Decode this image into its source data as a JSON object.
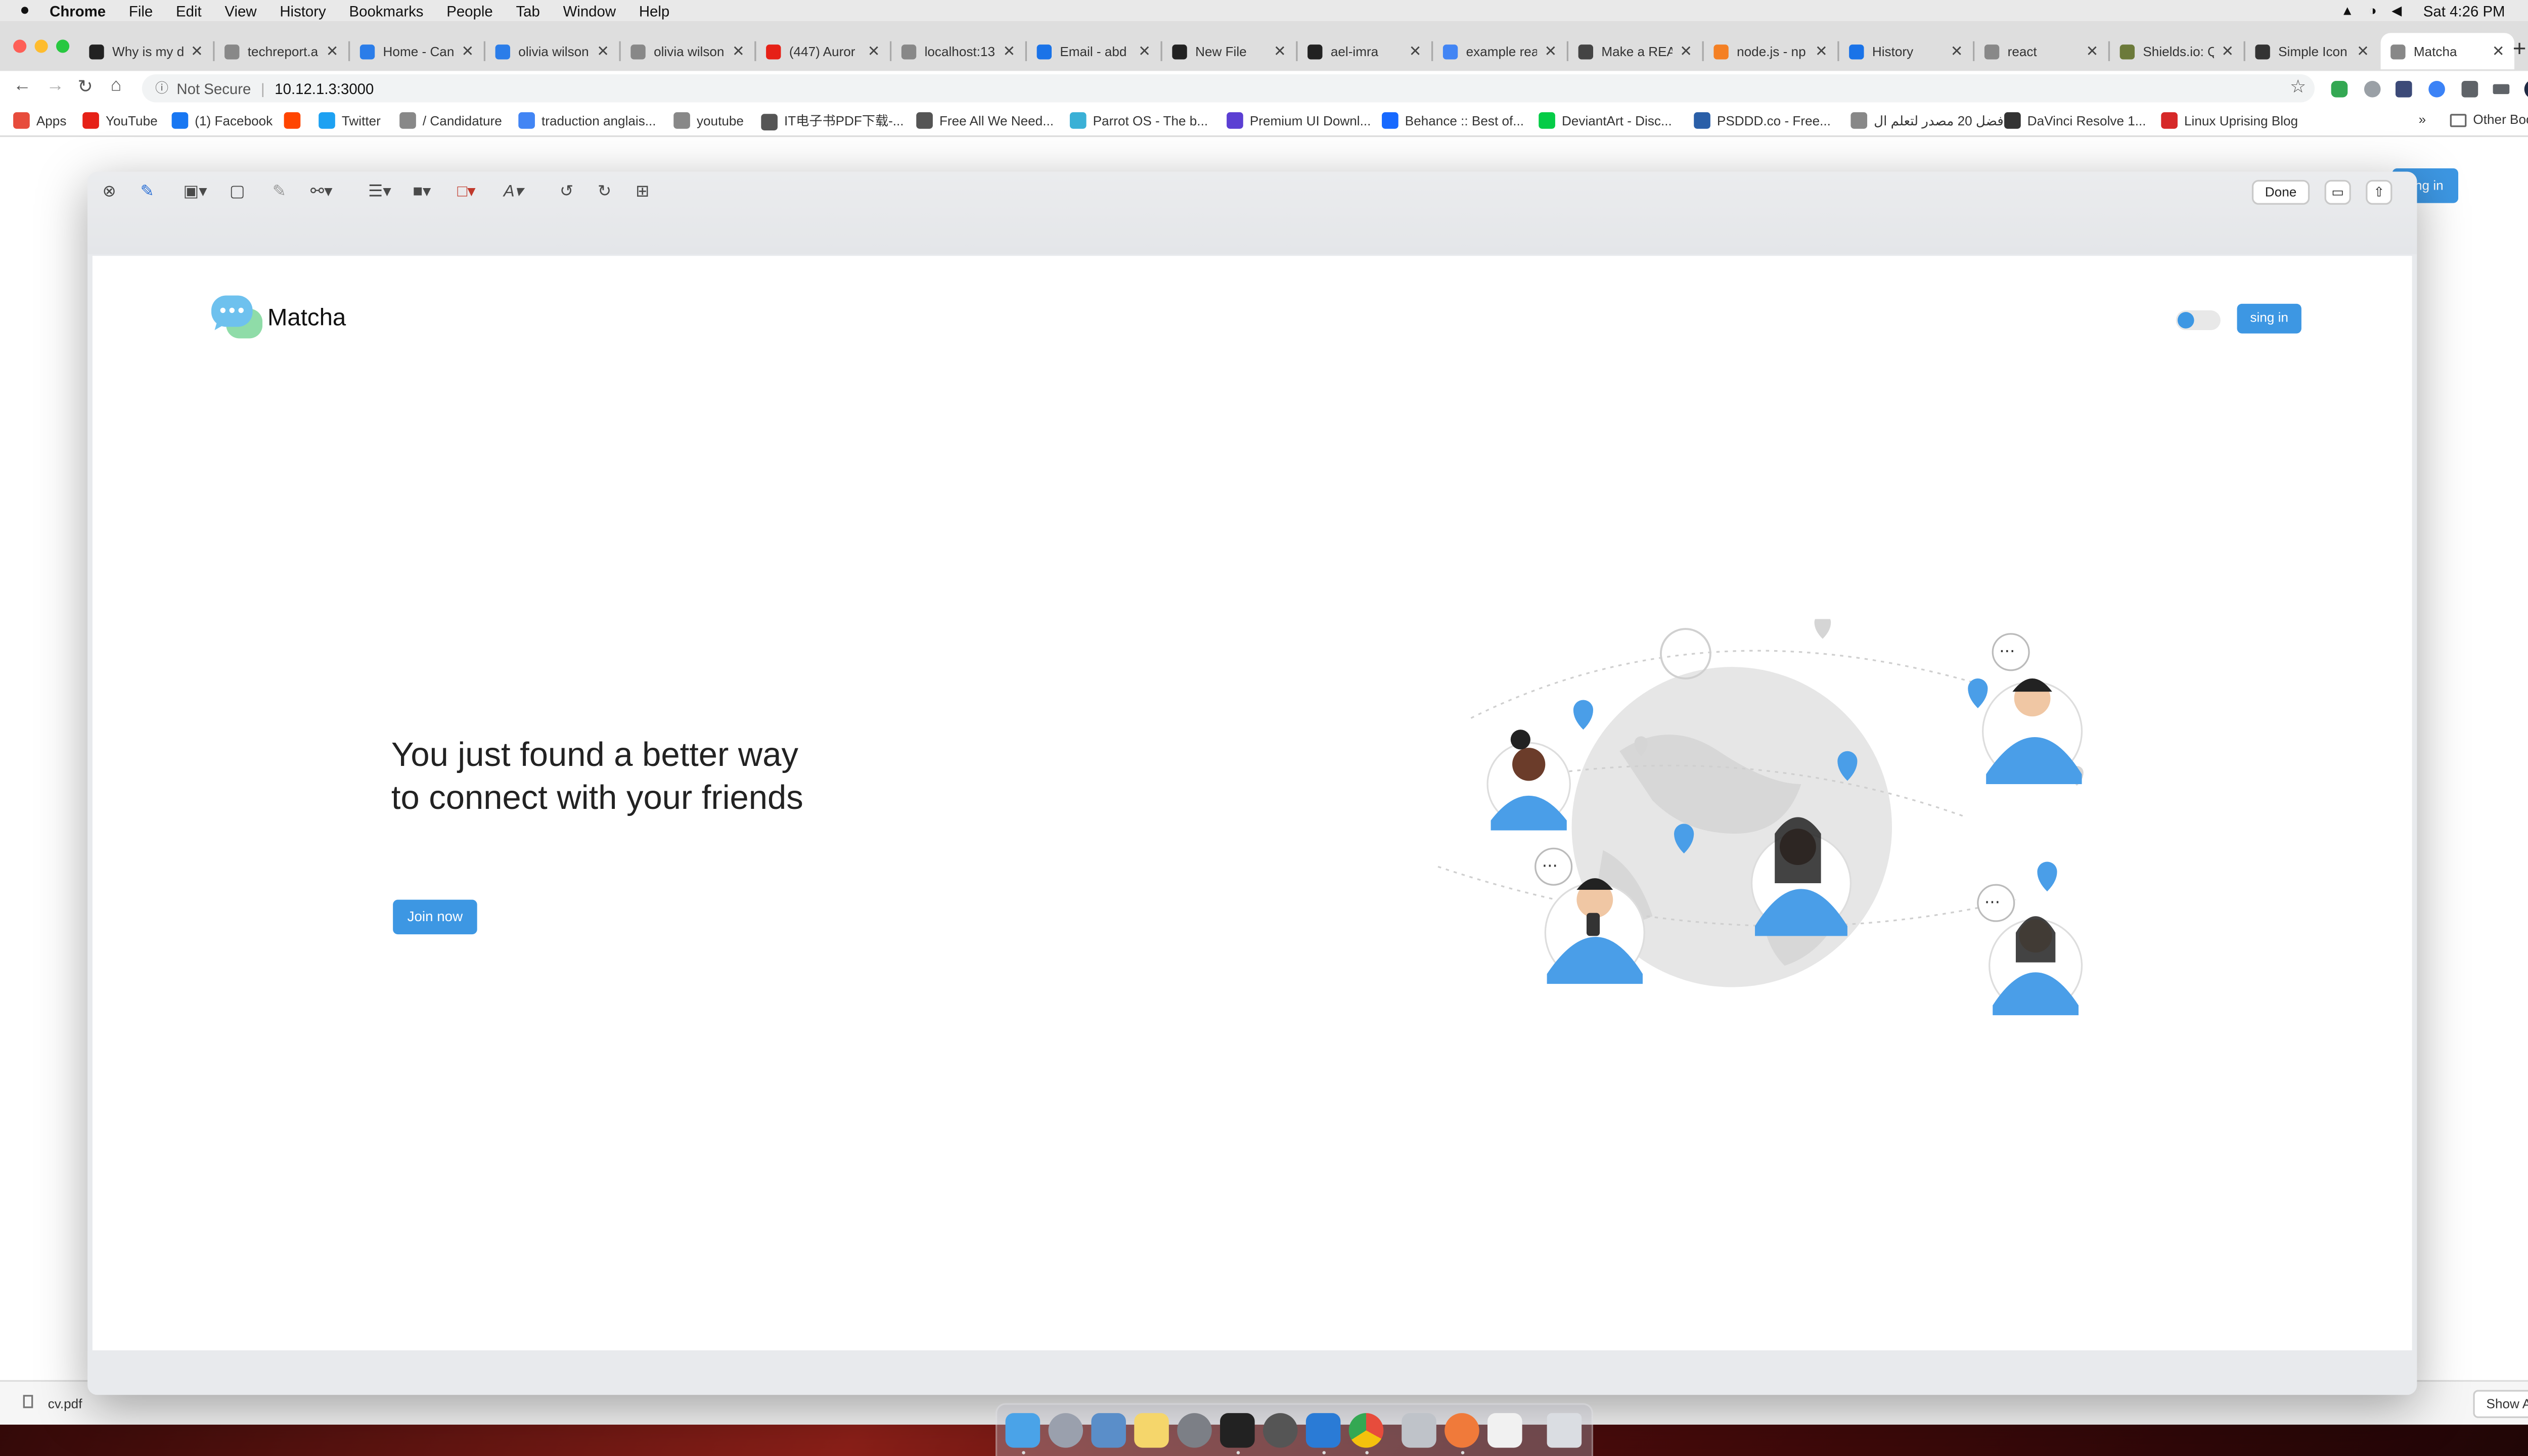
{
  "menubar": {
    "app": "Chrome",
    "items": [
      "File",
      "Edit",
      "View",
      "History",
      "Bookmarks",
      "People",
      "Tab",
      "Window",
      "Help"
    ],
    "clock": "Sat 4:26 PM"
  },
  "tabs": [
    {
      "label": "Why is my d",
      "color": "#222222"
    },
    {
      "label": "techreport.a",
      "color": "#888888"
    },
    {
      "label": "Home - Can",
      "color": "#2b7de9"
    },
    {
      "label": "olivia wilson",
      "color": "#2b7de9"
    },
    {
      "label": "olivia wilson",
      "color": "#888888"
    },
    {
      "label": "(447) Auror",
      "color": "#e62117"
    },
    {
      "label": "localhost:13",
      "color": "#888888"
    },
    {
      "label": "Email - abd",
      "color": "#1a73e8"
    },
    {
      "label": "New File",
      "color": "#222222"
    },
    {
      "label": "ael-imra",
      "color": "#222222"
    },
    {
      "label": "example rea",
      "color": "#4285f4"
    },
    {
      "label": "Make a REA",
      "color": "#444444"
    },
    {
      "label": "node.js - np",
      "color": "#f48024"
    },
    {
      "label": "History",
      "color": "#1a73e8"
    },
    {
      "label": "react",
      "color": "#888888"
    },
    {
      "label": "Shields.io: Q",
      "color": "#6c7a3a"
    },
    {
      "label": "Simple Icon",
      "color": "#333333"
    },
    {
      "label": "Matcha",
      "color": "#888888"
    }
  ],
  "address": {
    "security": "Not Secure",
    "url": "10.12.1.3:3000"
  },
  "bookmarks": [
    {
      "label": "Apps",
      "color": "#e74c3c"
    },
    {
      "label": "YouTube",
      "color": "#e62117"
    },
    {
      "label": "(1) Facebook",
      "color": "#1877f2"
    },
    {
      "label": "",
      "color": "#ff4500"
    },
    {
      "label": "Twitter",
      "color": "#1da1f2"
    },
    {
      "label": "/ Candidature",
      "color": "#888888"
    },
    {
      "label": "traduction anglais...",
      "color": "#4285f4"
    },
    {
      "label": "youtube",
      "color": "#888888"
    },
    {
      "label": "IT电子书PDF下载-...",
      "color": "#555555"
    },
    {
      "label": "Free All We Need...",
      "color": "#555555"
    },
    {
      "label": "Parrot OS - The b...",
      "color": "#3ab0d6"
    },
    {
      "label": "Premium UI Downl...",
      "color": "#5b3fd3"
    },
    {
      "label": "Behance :: Best of...",
      "color": "#1769ff"
    },
    {
      "label": "DeviantArt - Disc...",
      "color": "#05cc47"
    },
    {
      "label": "PSDDD.co - Free...",
      "color": "#2a5fa8"
    },
    {
      "label": "افضل 20 مصدر لتعلم ال...",
      "color": "#888888"
    },
    {
      "label": "DaVinci Resolve 1...",
      "color": "#333333"
    },
    {
      "label": "Linux Uprising Blog",
      "color": "#d62828"
    }
  ],
  "bookmarks_overflow": "»",
  "other_bookmarks": "Other Bookmarks",
  "background_signin": "sing in",
  "markup": {
    "done_label": "Done"
  },
  "site": {
    "brand": "Matcha",
    "signin_label": "sing in",
    "hero_text": "You just found a better way to connect with your friends",
    "join_label": "Join now",
    "accent_color": "#3d97e3"
  },
  "downloads": {
    "file": "cv.pdf",
    "show_all": "Show All"
  },
  "icons": {
    "close": "✕",
    "back": "←",
    "forward": "→",
    "reload": "↻",
    "home": "⌂",
    "star": "☆",
    "new_tab": "+"
  }
}
